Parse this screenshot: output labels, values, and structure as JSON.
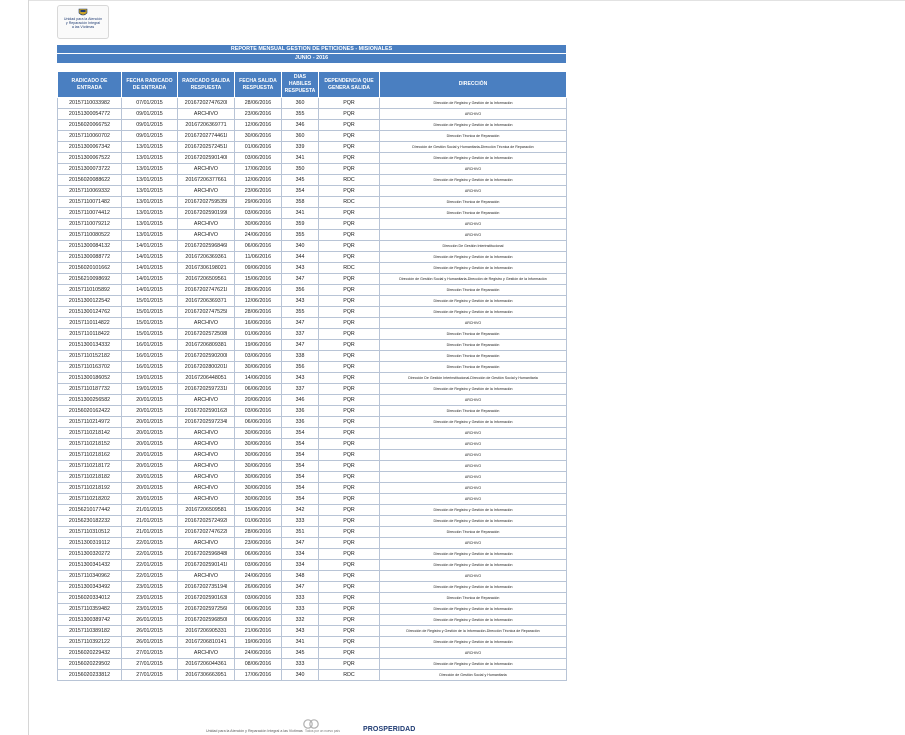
{
  "logo": {
    "line1": "Unidad para la Atención",
    "line2": "y Reparación Integral",
    "line3": "a las Víctimas"
  },
  "report": {
    "title": "REPORTE MENSUAL GESTION DE PETICIONES - MISIONALES",
    "period": "JUNIO - 2016"
  },
  "columns": [
    "RADICADO DE ENTRADA",
    "FECHA RADICADO DE ENTRADA",
    "RADICADO SALIDA RESPUESTA",
    "FECHA SALIDA RESPUESTA",
    "DIAS HABILES RESPUESTA",
    "DEPENDENCIA QUE GENERA SALIDA",
    "DIRECCIÓN"
  ],
  "rows": [
    [
      "20157110033982",
      "07/01/2015",
      "20167202747620l",
      "28/06/2016",
      "360",
      "PQR",
      "Dirección de Registro y Gestión de la Información"
    ],
    [
      "20151300054772",
      "09/01/2015",
      "ARCHIVO",
      "23/06/2016",
      "355",
      "PQR",
      "ARCHIVO"
    ],
    [
      "20156020066752",
      "09/01/2015",
      "20167206369771",
      "12/06/2016",
      "346",
      "PQR",
      "Dirección de Registro y Gestión de la Información"
    ],
    [
      "20157110060702",
      "09/01/2015",
      "20167202774461l",
      "30/06/2016",
      "360",
      "PQR",
      "Dirección Técnica de Reparación"
    ],
    [
      "20151300067342",
      "13/01/2015",
      "20167202572451l",
      "01/06/2016",
      "339",
      "PQR",
      "Dirección de Gestión Social y Humanitaria-Dirección Técnica de Reparación"
    ],
    [
      "20151300067522",
      "13/01/2015",
      "20167202590140l",
      "03/06/2016",
      "341",
      "PQR",
      "Dirección de Registro y Gestión de la Información"
    ],
    [
      "20151300073722",
      "13/01/2015",
      "ARCHIVO",
      "17/06/2016",
      "350",
      "PQR",
      "ARCHIVO"
    ],
    [
      "20156020088622",
      "13/01/2015",
      "20167206377661",
      "12/06/2016",
      "345",
      "RDC",
      "Dirección de Registro y Gestión de la Información"
    ],
    [
      "20157110069332",
      "13/01/2015",
      "ARCHIVO",
      "23/06/2016",
      "354",
      "PQR",
      "ARCHIVO"
    ],
    [
      "20157110071482",
      "13/01/2015",
      "20167202759535l",
      "29/06/2016",
      "358",
      "RDC",
      "Dirección Técnica de Reparación"
    ],
    [
      "20157110074412",
      "13/01/2015",
      "20167202590199l",
      "03/06/2016",
      "341",
      "PQR",
      "Dirección Técnica de Reparación"
    ],
    [
      "20157110079212",
      "13/01/2015",
      "ARCHIVO",
      "30/06/2016",
      "359",
      "PQR",
      "ARCHIVO"
    ],
    [
      "20157110080522",
      "13/01/2015",
      "ARCHIVO",
      "24/06/2016",
      "355",
      "PQR",
      "ARCHIVO"
    ],
    [
      "20151300084132",
      "14/01/2015",
      "20167202596846l",
      "06/06/2016",
      "340",
      "PQR",
      "Dirección De Gestión Interinstitucional"
    ],
    [
      "20151300088772",
      "14/01/2015",
      "20167206369361",
      "11/06/2016",
      "344",
      "PQR",
      "Dirección de Registro y Gestión de la Información"
    ],
    [
      "20156020101662",
      "14/01/2015",
      "20167306198021",
      "09/06/2016",
      "343",
      "RDC",
      "Dirección de Registro y Gestión de la Información"
    ],
    [
      "20156210098692",
      "14/01/2015",
      "20167206509561",
      "15/06/2016",
      "347",
      "PQR",
      "Dirección de Gestión Social y Humanitaria-Dirección de Registro y Gestión de la Información"
    ],
    [
      "20157110105892",
      "14/01/2015",
      "20167202747621l",
      "28/06/2016",
      "356",
      "PQR",
      "Dirección Técnica de Reparación"
    ],
    [
      "20151300122542",
      "15/01/2015",
      "20167206369371",
      "12/06/2016",
      "343",
      "PQR",
      "Dirección de Registro y Gestión de la Información"
    ],
    [
      "20151300124762",
      "15/01/2015",
      "20167202747525l",
      "28/06/2016",
      "355",
      "PQR",
      "Dirección de Registro y Gestión de la Información"
    ],
    [
      "20157110114822",
      "15/01/2015",
      "ARCHIVO",
      "16/06/2016",
      "347",
      "PQR",
      "ARCHIVO"
    ],
    [
      "20157110118422",
      "15/01/2015",
      "20167202572508l",
      "01/06/2016",
      "337",
      "PQR",
      "Dirección Técnica de Reparación"
    ],
    [
      "20151300134332",
      "16/01/2015",
      "20167206809381",
      "19/06/2016",
      "347",
      "PQR",
      "Dirección Técnica de Reparación"
    ],
    [
      "20157110152182",
      "16/01/2015",
      "20167202590200l",
      "03/06/2016",
      "338",
      "PQR",
      "Dirección Técnica de Reparación"
    ],
    [
      "20157110163702",
      "16/01/2015",
      "20167202800201l",
      "30/06/2016",
      "356",
      "PQR",
      "Dirección Técnica de Reparación"
    ],
    [
      "20151300186052",
      "19/01/2015",
      "20167206448051",
      "14/06/2016",
      "343",
      "PQR",
      "Dirección De Gestión Interinstitucional-Dirección de Gestión Social y Humanitaria"
    ],
    [
      "20157110187732",
      "19/01/2015",
      "20167202597231l",
      "06/06/2016",
      "337",
      "PQR",
      "Dirección de Registro y Gestión de la Información"
    ],
    [
      "20151300256582",
      "20/01/2015",
      "ARCHIVO",
      "20/06/2016",
      "346",
      "PQR",
      "ARCHIVO"
    ],
    [
      "20156020162422",
      "20/01/2015",
      "20167202590162l",
      "03/06/2016",
      "336",
      "PQR",
      "Dirección Técnica de Reparación"
    ],
    [
      "20157110214972",
      "20/01/2015",
      "20167202597234l",
      "06/06/2016",
      "336",
      "PQR",
      "Dirección de Registro y Gestión de la Información"
    ],
    [
      "20157110218142",
      "20/01/2015",
      "ARCHIVO",
      "30/06/2016",
      "354",
      "PQR",
      "ARCHIVO"
    ],
    [
      "20157110218152",
      "20/01/2015",
      "ARCHIVO",
      "30/06/2016",
      "354",
      "PQR",
      "ARCHIVO"
    ],
    [
      "20157110218162",
      "20/01/2015",
      "ARCHIVO",
      "30/06/2016",
      "354",
      "PQR",
      "ARCHIVO"
    ],
    [
      "20157110218172",
      "20/01/2015",
      "ARCHIVO",
      "30/06/2016",
      "354",
      "PQR",
      "ARCHIVO"
    ],
    [
      "20157110218182",
      "20/01/2015",
      "ARCHIVO",
      "30/06/2016",
      "354",
      "PQR",
      "ARCHIVO"
    ],
    [
      "20157110218192",
      "20/01/2015",
      "ARCHIVO",
      "30/06/2016",
      "354",
      "PQR",
      "ARCHIVO"
    ],
    [
      "20157110218202",
      "20/01/2015",
      "ARCHIVO",
      "30/06/2016",
      "354",
      "PQR",
      "ARCHIVO"
    ],
    [
      "20156210177442",
      "21/01/2015",
      "20167206509581",
      "15/06/2016",
      "342",
      "PQR",
      "Dirección de Registro y Gestión de la Información"
    ],
    [
      "20156230182232",
      "21/01/2015",
      "20167202572492l",
      "01/06/2016",
      "333",
      "PQR",
      "Dirección de Registro y Gestión de la Información"
    ],
    [
      "20157110310512",
      "21/01/2015",
      "20167202747622l",
      "28/06/2016",
      "351",
      "PQR",
      "Dirección Técnica de Reparación"
    ],
    [
      "20151300319112",
      "22/01/2015",
      "ARCHIVO",
      "23/06/2016",
      "347",
      "PQR",
      "ARCHIVO"
    ],
    [
      "20151300320272",
      "22/01/2015",
      "20167202596848l",
      "06/06/2016",
      "334",
      "PQR",
      "Dirección de Registro y Gestión de la Información"
    ],
    [
      "20151300341432",
      "22/01/2015",
      "20167202590141l",
      "03/06/2016",
      "334",
      "PQR",
      "Dirección de Registro y Gestión de la Información"
    ],
    [
      "20157110340962",
      "22/01/2015",
      "ARCHIVO",
      "24/06/2016",
      "348",
      "PQR",
      "ARCHIVO"
    ],
    [
      "20151300343492",
      "23/01/2015",
      "20167202735194l",
      "26/06/2016",
      "347",
      "PQR",
      "Dirección de Registro y Gestión de la Información"
    ],
    [
      "20156020334012",
      "23/01/2015",
      "20167202590163l",
      "03/06/2016",
      "333",
      "PQR",
      "Dirección Técnica de Reparación"
    ],
    [
      "20157110359482",
      "23/01/2015",
      "20167202597256l",
      "06/06/2016",
      "333",
      "PQR",
      "Dirección de Registro y Gestión de la Información"
    ],
    [
      "20151300389742",
      "26/01/2015",
      "20167202596850l",
      "06/06/2016",
      "332",
      "PQR",
      "Dirección de Registro y Gestión de la Información"
    ],
    [
      "20157110389182",
      "26/01/2015",
      "20167206905331",
      "21/06/2016",
      "343",
      "PQR",
      "Dirección de Registro y Gestión de la Información-Dirección Técnica de Reparación"
    ],
    [
      "20157110392122",
      "26/01/2015",
      "20167206810141",
      "19/06/2016",
      "341",
      "PQR",
      "Dirección de Registro y Gestión de la Información"
    ],
    [
      "20156020229432",
      "27/01/2015",
      "ARCHIVO",
      "24/06/2016",
      "345",
      "PQR",
      "ARCHIVO"
    ],
    [
      "20156020229502",
      "27/01/2015",
      "20167206044361",
      "08/06/2016",
      "333",
      "PQR",
      "Dirección de Registro y Gestión de la Información"
    ],
    [
      "20156020233812",
      "27/01/2015",
      "20167306663951",
      "17/06/2016",
      "340",
      "RDC",
      "Dirección de Gestión Social y Humanitaria"
    ]
  ],
  "footer": {
    "caption": "Unidad para la Atención y Reparación Integral a las Víctimas",
    "mark_sub": "Todos por un nuevo país",
    "brand": "PROSPERIDAD"
  },
  "colors": {
    "header_blue": "#4a7fc1",
    "brand_navy": "#1f3b73"
  }
}
